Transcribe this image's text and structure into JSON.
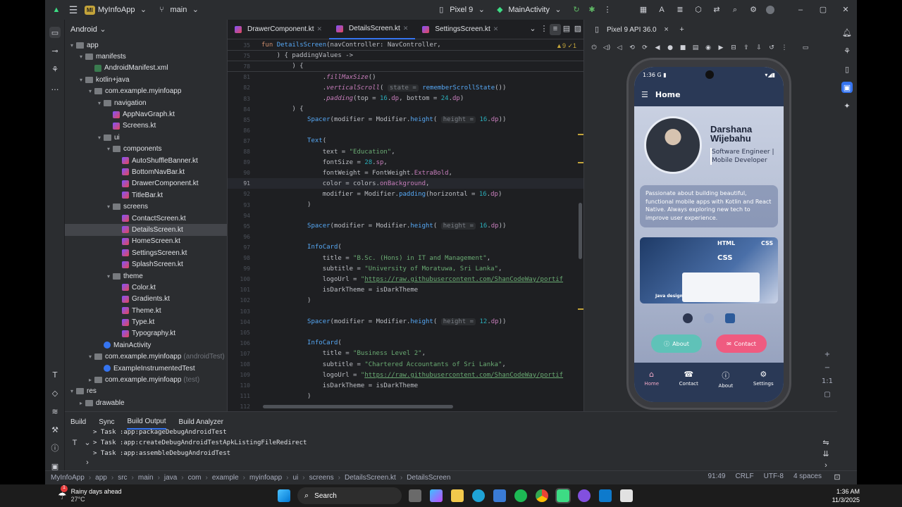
{
  "titlebar": {
    "project_badge": "MI",
    "project": "MyInfoApp",
    "branch": "main",
    "device": "Pixel 9",
    "run_config": "MainActivity"
  },
  "project_panel": {
    "title": "Android",
    "tree": [
      {
        "label": "app",
        "indent": 0,
        "icon": "folder",
        "arrow": "▾"
      },
      {
        "label": "manifests",
        "indent": 1,
        "icon": "folder",
        "arrow": "▾"
      },
      {
        "label": "AndroidManifest.xml",
        "indent": 2,
        "icon": "xml",
        "arrow": ""
      },
      {
        "label": "kotlin+java",
        "indent": 1,
        "icon": "folder",
        "arrow": "▾"
      },
      {
        "label": "com.example.myinfoapp",
        "indent": 2,
        "icon": "folder",
        "arrow": "▾"
      },
      {
        "label": "navigation",
        "indent": 3,
        "icon": "folder",
        "arrow": "▾"
      },
      {
        "label": "AppNavGraph.kt",
        "indent": 4,
        "icon": "kt",
        "arrow": ""
      },
      {
        "label": "Screens.kt",
        "indent": 4,
        "icon": "kt",
        "arrow": ""
      },
      {
        "label": "ui",
        "indent": 3,
        "icon": "folder",
        "arrow": "▾"
      },
      {
        "label": "components",
        "indent": 4,
        "icon": "folder",
        "arrow": "▾"
      },
      {
        "label": "AutoShuffleBanner.kt",
        "indent": 5,
        "icon": "kt",
        "arrow": ""
      },
      {
        "label": "BottomNavBar.kt",
        "indent": 5,
        "icon": "kt",
        "arrow": ""
      },
      {
        "label": "DrawerComponent.kt",
        "indent": 5,
        "icon": "kt",
        "arrow": ""
      },
      {
        "label": "TitleBar.kt",
        "indent": 5,
        "icon": "kt",
        "arrow": ""
      },
      {
        "label": "screens",
        "indent": 4,
        "icon": "folder",
        "arrow": "▾"
      },
      {
        "label": "ContactScreen.kt",
        "indent": 5,
        "icon": "kt",
        "arrow": ""
      },
      {
        "label": "DetailsScreen.kt",
        "indent": 5,
        "icon": "kt",
        "arrow": "",
        "selected": true
      },
      {
        "label": "HomeScreen.kt",
        "indent": 5,
        "icon": "kt",
        "arrow": ""
      },
      {
        "label": "SettingsScreen.kt",
        "indent": 5,
        "icon": "kt",
        "arrow": ""
      },
      {
        "label": "SplashScreen.kt",
        "indent": 5,
        "icon": "kt",
        "arrow": ""
      },
      {
        "label": "theme",
        "indent": 4,
        "icon": "folder",
        "arrow": "▾"
      },
      {
        "label": "Color.kt",
        "indent": 5,
        "icon": "kt",
        "arrow": ""
      },
      {
        "label": "Gradients.kt",
        "indent": 5,
        "icon": "kt",
        "arrow": ""
      },
      {
        "label": "Theme.kt",
        "indent": 5,
        "icon": "kt",
        "arrow": ""
      },
      {
        "label": "Type.kt",
        "indent": 5,
        "icon": "kt",
        "arrow": ""
      },
      {
        "label": "Typography.kt",
        "indent": 5,
        "icon": "kt",
        "arrow": ""
      },
      {
        "label": "MainActivity",
        "indent": 3,
        "icon": "cls",
        "arrow": ""
      },
      {
        "label": "com.example.myinfoapp",
        "indent": 2,
        "icon": "folder",
        "arrow": "▾",
        "suffix": "(androidTest)"
      },
      {
        "label": "ExampleInstrumentedTest",
        "indent": 3,
        "icon": "cls",
        "arrow": ""
      },
      {
        "label": "com.example.myinfoapp",
        "indent": 2,
        "icon": "folder",
        "arrow": "▸",
        "suffix": "(test)"
      },
      {
        "label": "res",
        "indent": 0,
        "icon": "folder",
        "arrow": "▾"
      },
      {
        "label": "drawable",
        "indent": 1,
        "icon": "folder",
        "arrow": "▸"
      }
    ]
  },
  "editor": {
    "tabs": [
      {
        "label": "DrawerComponent.kt",
        "active": false
      },
      {
        "label": "DetailsScreen.kt",
        "active": true
      },
      {
        "label": "SettingsScreen.kt",
        "active": false
      }
    ],
    "warnings": "▲9 ✓1",
    "sticky": [
      {
        "n": "35",
        "html": "<span class='kw'>fun</span> <span class='fn'>DetailsScreen</span>(navController: NavController,"
      },
      {
        "n": "75",
        "html": "    ) { paddingValues ->"
      },
      {
        "n": "78",
        "html": "        ) {"
      }
    ],
    "lines": [
      {
        "n": "81",
        "html": "                .<span class='ital'>fillMaxSize</span>()"
      },
      {
        "n": "82",
        "html": "                .<span class='ital'>verticalScroll</span>( <span class='hint'>state =</span> <span class='fn'>rememberScrollState</span>())"
      },
      {
        "n": "83",
        "html": "                .<span class='ital'>padding</span>(top = <span class='num'>16</span>.<span class='prop'>dp</span>, bottom = <span class='num'>24</span>.<span class='prop'>dp</span>)"
      },
      {
        "n": "84",
        "html": "        ) {"
      },
      {
        "n": "85",
        "html": "            <span class='fn'>Spacer</span>(modifier = Modifier.<span class='fn'>height</span>( <span class='hint'>height =</span> <span class='num'>16</span>.<span class='prop'>dp</span>))"
      },
      {
        "n": "86",
        "html": ""
      },
      {
        "n": "87",
        "html": "            <span class='fn'>Text</span>("
      },
      {
        "n": "88",
        "html": "                text = <span class='str'>\"Education\"</span>,"
      },
      {
        "n": "89",
        "html": "                fontSize = <span class='num'>28</span>.<span class='prop'>sp</span>,"
      },
      {
        "n": "90",
        "html": "                fontWeight = FontWeight.<span class='prop'>ExtraBold</span>,"
      },
      {
        "n": "91",
        "html": "                color = colors.<span class='prop'>onBackground</span>,",
        "cur": true
      },
      {
        "n": "92",
        "html": "                modifier = Modifier.<span class='fn'>padding</span>(horizontal = <span class='num'>16</span>.<span class='prop'>dp</span>)"
      },
      {
        "n": "93",
        "html": "            )"
      },
      {
        "n": "94",
        "html": ""
      },
      {
        "n": "95",
        "html": "            <span class='fn'>Spacer</span>(modifier = Modifier.<span class='fn'>height</span>( <span class='hint'>height =</span> <span class='num'>16</span>.<span class='prop'>dp</span>))"
      },
      {
        "n": "96",
        "html": ""
      },
      {
        "n": "97",
        "html": "            <span class='fn'>InfoCard</span>("
      },
      {
        "n": "98",
        "html": "                title = <span class='str'>\"B.Sc. (Hons) in IT and Management\"</span>,"
      },
      {
        "n": "99",
        "html": "                subtitle = <span class='str'>\"University of Moratuwa, Sri Lanka\"</span>,"
      },
      {
        "n": "100",
        "html": "                logoUrl = <span class='str'>\"<span class='url'>https://raw.githubusercontent.com/ShanCodeWay/portif</span></span>"
      },
      {
        "n": "101",
        "html": "                isDarkTheme = isDarkTheme"
      },
      {
        "n": "102",
        "html": "            )"
      },
      {
        "n": "103",
        "html": ""
      },
      {
        "n": "104",
        "html": "            <span class='fn'>Spacer</span>(modifier = Modifier.<span class='fn'>height</span>( <span class='hint'>height =</span> <span class='num'>12</span>.<span class='prop'>dp</span>))"
      },
      {
        "n": "105",
        "html": ""
      },
      {
        "n": "106",
        "html": "            <span class='fn'>InfoCard</span>("
      },
      {
        "n": "107",
        "html": "                title = <span class='str'>\"Business Level 2\"</span>,"
      },
      {
        "n": "108",
        "html": "                subtitle = <span class='str'>\"Chartered Accountants of Sri Lanka\"</span>,"
      },
      {
        "n": "109",
        "html": "                logoUrl = <span class='str'>\"<span class='url'>https://raw.githubusercontent.com/ShanCodeWay/portif</span></span>"
      },
      {
        "n": "110",
        "html": "                isDarkTheme = isDarkTheme"
      },
      {
        "n": "111",
        "html": "            )"
      },
      {
        "n": "112",
        "html": ""
      }
    ]
  },
  "running": {
    "tab": "Pixel 9 API 36.0"
  },
  "phone": {
    "time": "1:36",
    "carrier_icon": "G",
    "appbar_title": "Home",
    "name": "Darshana Wijebahu",
    "role": "Software Engineer | Mobile Developer",
    "description": "Passionate about building beautiful, functional mobile apps with Kotlin and React Native. Always exploring new tech to improve user experience.",
    "banner": {
      "html": "HTML",
      "css": "CSS",
      "css2": "CSS",
      "java": "Java design"
    },
    "about_btn": "About",
    "contact_btn": "Contact",
    "about_color": "#5fc2b8",
    "contact_color": "#ef5b80",
    "nav": [
      {
        "label": "Home",
        "icon": "⌂",
        "active": true
      },
      {
        "label": "Contact",
        "icon": "☎",
        "active": false
      },
      {
        "label": "About",
        "icon": "ⓘ",
        "active": false
      },
      {
        "label": "Settings",
        "icon": "⚙",
        "active": false
      }
    ]
  },
  "build": {
    "tabs": [
      "Build",
      "Sync",
      "Build Output",
      "Build Analyzer"
    ],
    "lines": [
      "> Task :app:packageDebugAndroidTest",
      "> Task :app:createDebugAndroidTestApkListingFileRedirect",
      "> Task :app:assembleDebugAndroidTest"
    ]
  },
  "statusbar": {
    "crumbs": [
      "MyInfoApp",
      "app",
      "src",
      "main",
      "java",
      "com",
      "example",
      "myinfoapp",
      "ui",
      "screens",
      "DetailsScreen.kt",
      "DetailsScreen"
    ],
    "position": "91:49",
    "line_sep": "CRLF",
    "encoding": "UTF-8",
    "indent": "4 spaces"
  },
  "taskbar": {
    "weather_title": "Rainy days ahead",
    "weather_temp": "27°C",
    "search": "Search",
    "time": "1:36 AM",
    "date": "11/3/2025",
    "notif_count": "1"
  }
}
